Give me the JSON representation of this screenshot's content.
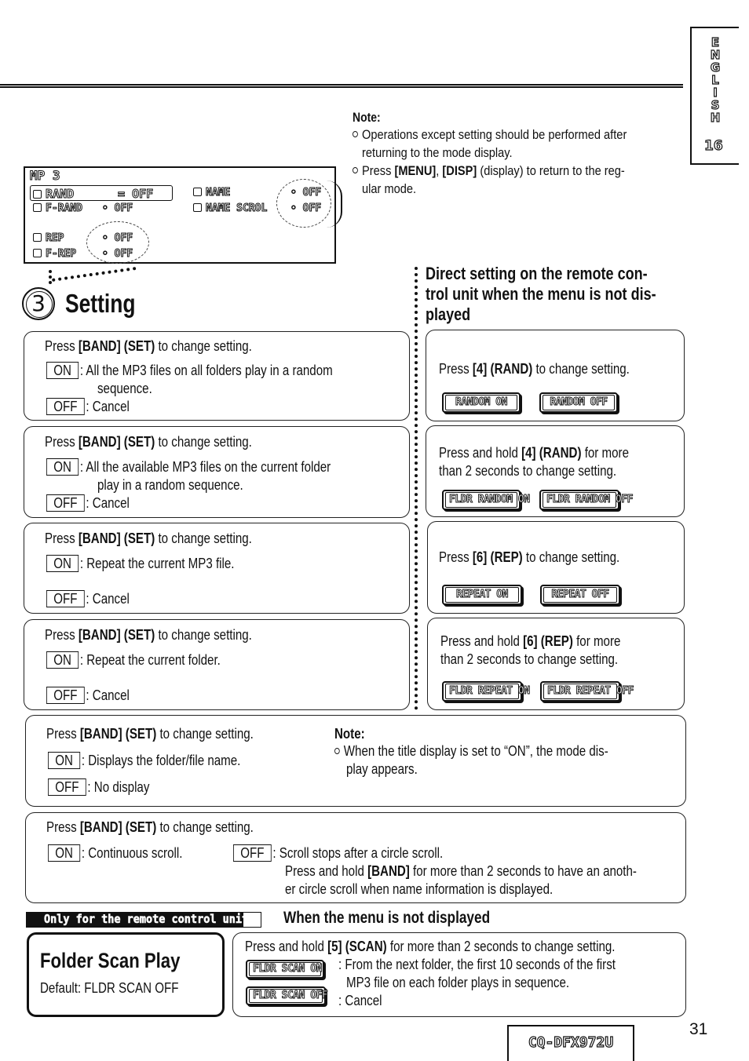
{
  "side_tab": {
    "language_letters": [
      "E",
      "N",
      "G",
      "L",
      "I",
      "S",
      "H"
    ],
    "number": "16"
  },
  "top_note": {
    "heading": "Note:",
    "bullets": [
      [
        "Operations except setting should be performed after",
        "returning to the mode display."
      ],
      [
        "Press [MENU], [DISP] (display) to return to the reg-",
        "ular mode."
      ]
    ]
  },
  "lcd_menu": {
    "title": "MP 3",
    "items": {
      "rand": {
        "label": "RAND",
        "value": "OFF"
      },
      "f_rand": {
        "label": "F-RAND",
        "value": "OFF"
      },
      "rep": {
        "label": "REP",
        "value": "OFF"
      },
      "f_rep": {
        "label": "F-REP",
        "value": "OFF"
      },
      "name": {
        "label": "NAME",
        "value": "OFF"
      },
      "name_scrol": {
        "label": "NAME SCROL",
        "value": "OFF"
      }
    }
  },
  "setting": {
    "step_number": "3",
    "title": "Setting"
  },
  "direct_heading": [
    "Direct setting on the remote con-",
    "trol unit when the menu is not dis-",
    "played"
  ],
  "left_panels": [
    {
      "instruction_pre": "Press ",
      "instruction_key": "[BAND] (SET)",
      "instruction_post": " to change setting.",
      "on_label": "ON",
      "on_desc": [
        ": All the MP3 files on all folders play in a random",
        "sequence."
      ],
      "off_label": "OFF",
      "off_desc": ": Cancel"
    },
    {
      "instruction_pre": "Press ",
      "instruction_key": "[BAND] (SET)",
      "instruction_post": " to change setting.",
      "on_label": "ON",
      "on_desc": [
        ": All the available MP3 files on the current folder",
        "play in a random sequence."
      ],
      "off_label": "OFF",
      "off_desc": ": Cancel"
    },
    {
      "instruction_pre": "Press ",
      "instruction_key": "[BAND] (SET)",
      "instruction_post": " to change setting.",
      "on_label": "ON",
      "on_desc": [
        ": Repeat the current MP3 file."
      ],
      "off_label": "OFF",
      "off_desc": ": Cancel"
    },
    {
      "instruction_pre": "Press ",
      "instruction_key": "[BAND] (SET)",
      "instruction_post": " to change setting.",
      "on_label": "ON",
      "on_desc": [
        ": Repeat the current folder."
      ],
      "off_label": "OFF",
      "off_desc": ": Cancel"
    }
  ],
  "right_panels": [
    {
      "text_pre": "Press ",
      "text_key": "[4] (RAND)",
      "text_post": " to change setting.",
      "text_line2": "",
      "badges": [
        "RANDOM ON",
        "RANDOM OFF"
      ]
    },
    {
      "text_pre": "Press and hold ",
      "text_key": "[4] (RAND)",
      "text_post": " for more",
      "text_line2": "than 2 seconds to change setting.",
      "badges": [
        "FLDR RANDOM ON",
        "FLDR RANDOM OFF"
      ]
    },
    {
      "text_pre": "Press ",
      "text_key": "[6] (REP)",
      "text_post": " to change setting.",
      "text_line2": "",
      "badges": [
        "REPEAT ON",
        "REPEAT OFF"
      ]
    },
    {
      "text_pre": "Press and hold ",
      "text_key": "[6] (REP)",
      "text_post": " for more",
      "text_line2": "than 2 seconds to change setting.",
      "badges": [
        "FLDR REPEAT ON",
        "FLDR REPEAT OFF"
      ]
    }
  ],
  "name_panel": {
    "instruction_pre": "Press ",
    "instruction_key": "[BAND] (SET)",
    "instruction_post": " to change setting.",
    "on_label": "ON",
    "on_desc": ": Displays the folder/file name.",
    "off_label": "OFF",
    "off_desc": ": No display",
    "note_heading": "Note:",
    "note_lines": [
      "When the title display is set to “ON”, the mode dis-",
      "play appears."
    ]
  },
  "scroll_panel": {
    "instruction_pre": "Press ",
    "instruction_key": "[BAND] (SET)",
    "instruction_post": " to change setting.",
    "on_label": "ON",
    "on_desc": ": Continuous scroll.",
    "off_label": "OFF",
    "off_desc": ": Scroll stops after a circle scroll.",
    "off_extra_pre": "Press and hold ",
    "off_extra_key": "[BAND]",
    "off_extra_post": " for more than 2 seconds to have an anoth-",
    "off_extra_line2": "er circle scroll when name information is displayed."
  },
  "remote_only_label": "Only for the remote control unit",
  "when_heading": "When the menu is not displayed",
  "folder_scan": {
    "title": "Folder Scan Play",
    "default": "Default: FLDR SCAN OFF",
    "instruction_pre": "Press and hold ",
    "instruction_key": "[5] (SCAN)",
    "instruction_post": " for more than 2 seconds to change setting.",
    "on_badge": "FLDR SCAN ON",
    "on_desc": [
      ": From the next folder, the first 10 seconds of the first",
      "MP3 file on each folder plays in sequence."
    ],
    "off_badge": "FLDR SCAN OFF",
    "off_desc": ": Cancel"
  },
  "footer": {
    "model": "CQ-DFX972U",
    "page_number": "31"
  }
}
